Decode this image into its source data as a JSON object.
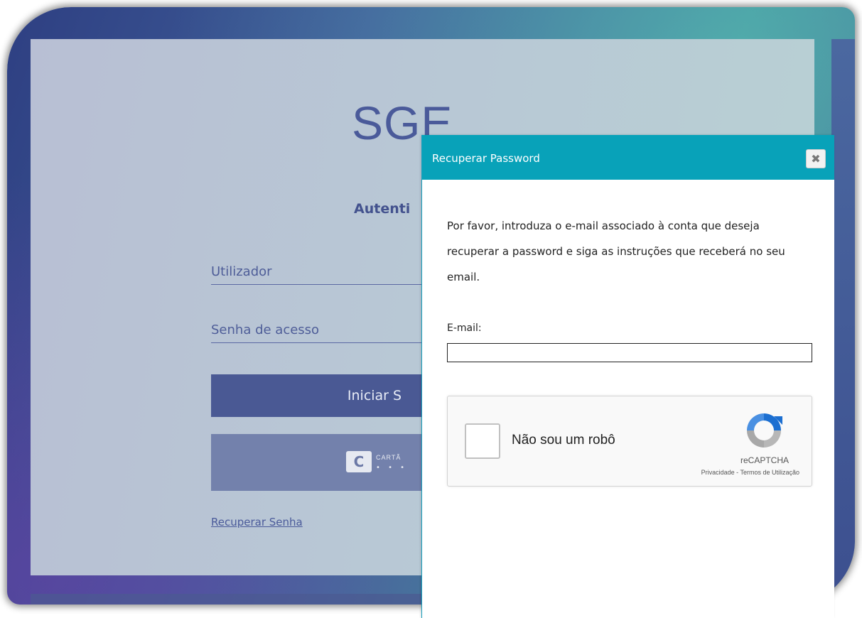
{
  "login": {
    "title": "SGE",
    "subtitle": "Autenti",
    "username_placeholder": "Utilizador",
    "password_placeholder": "Senha de acesso",
    "login_button": "Iniciar S",
    "cc_button_text": "CARTÃ",
    "cc_button_dots": "• • •",
    "cc_logo_glyph": "C",
    "recover_link": "Recuperar Senha"
  },
  "modal": {
    "title": "Recuperar Password",
    "close_glyph": "✖",
    "instructions": "Por favor, introduza o e-mail associado à conta que deseja recuperar a password e siga as instruções que receberá no seu email.",
    "email_label": "E-mail:",
    "email_value": ""
  },
  "recaptcha": {
    "checkbox_label": "Não sou um robô",
    "brand": "reCAPTCHA",
    "links": "Privacidade - Termos de Utilização"
  },
  "colors": {
    "modal_header": "#08a2b9",
    "login_button": "#4a5994",
    "cc_button": "#7381ac",
    "brand_text": "#4a5a9a"
  }
}
